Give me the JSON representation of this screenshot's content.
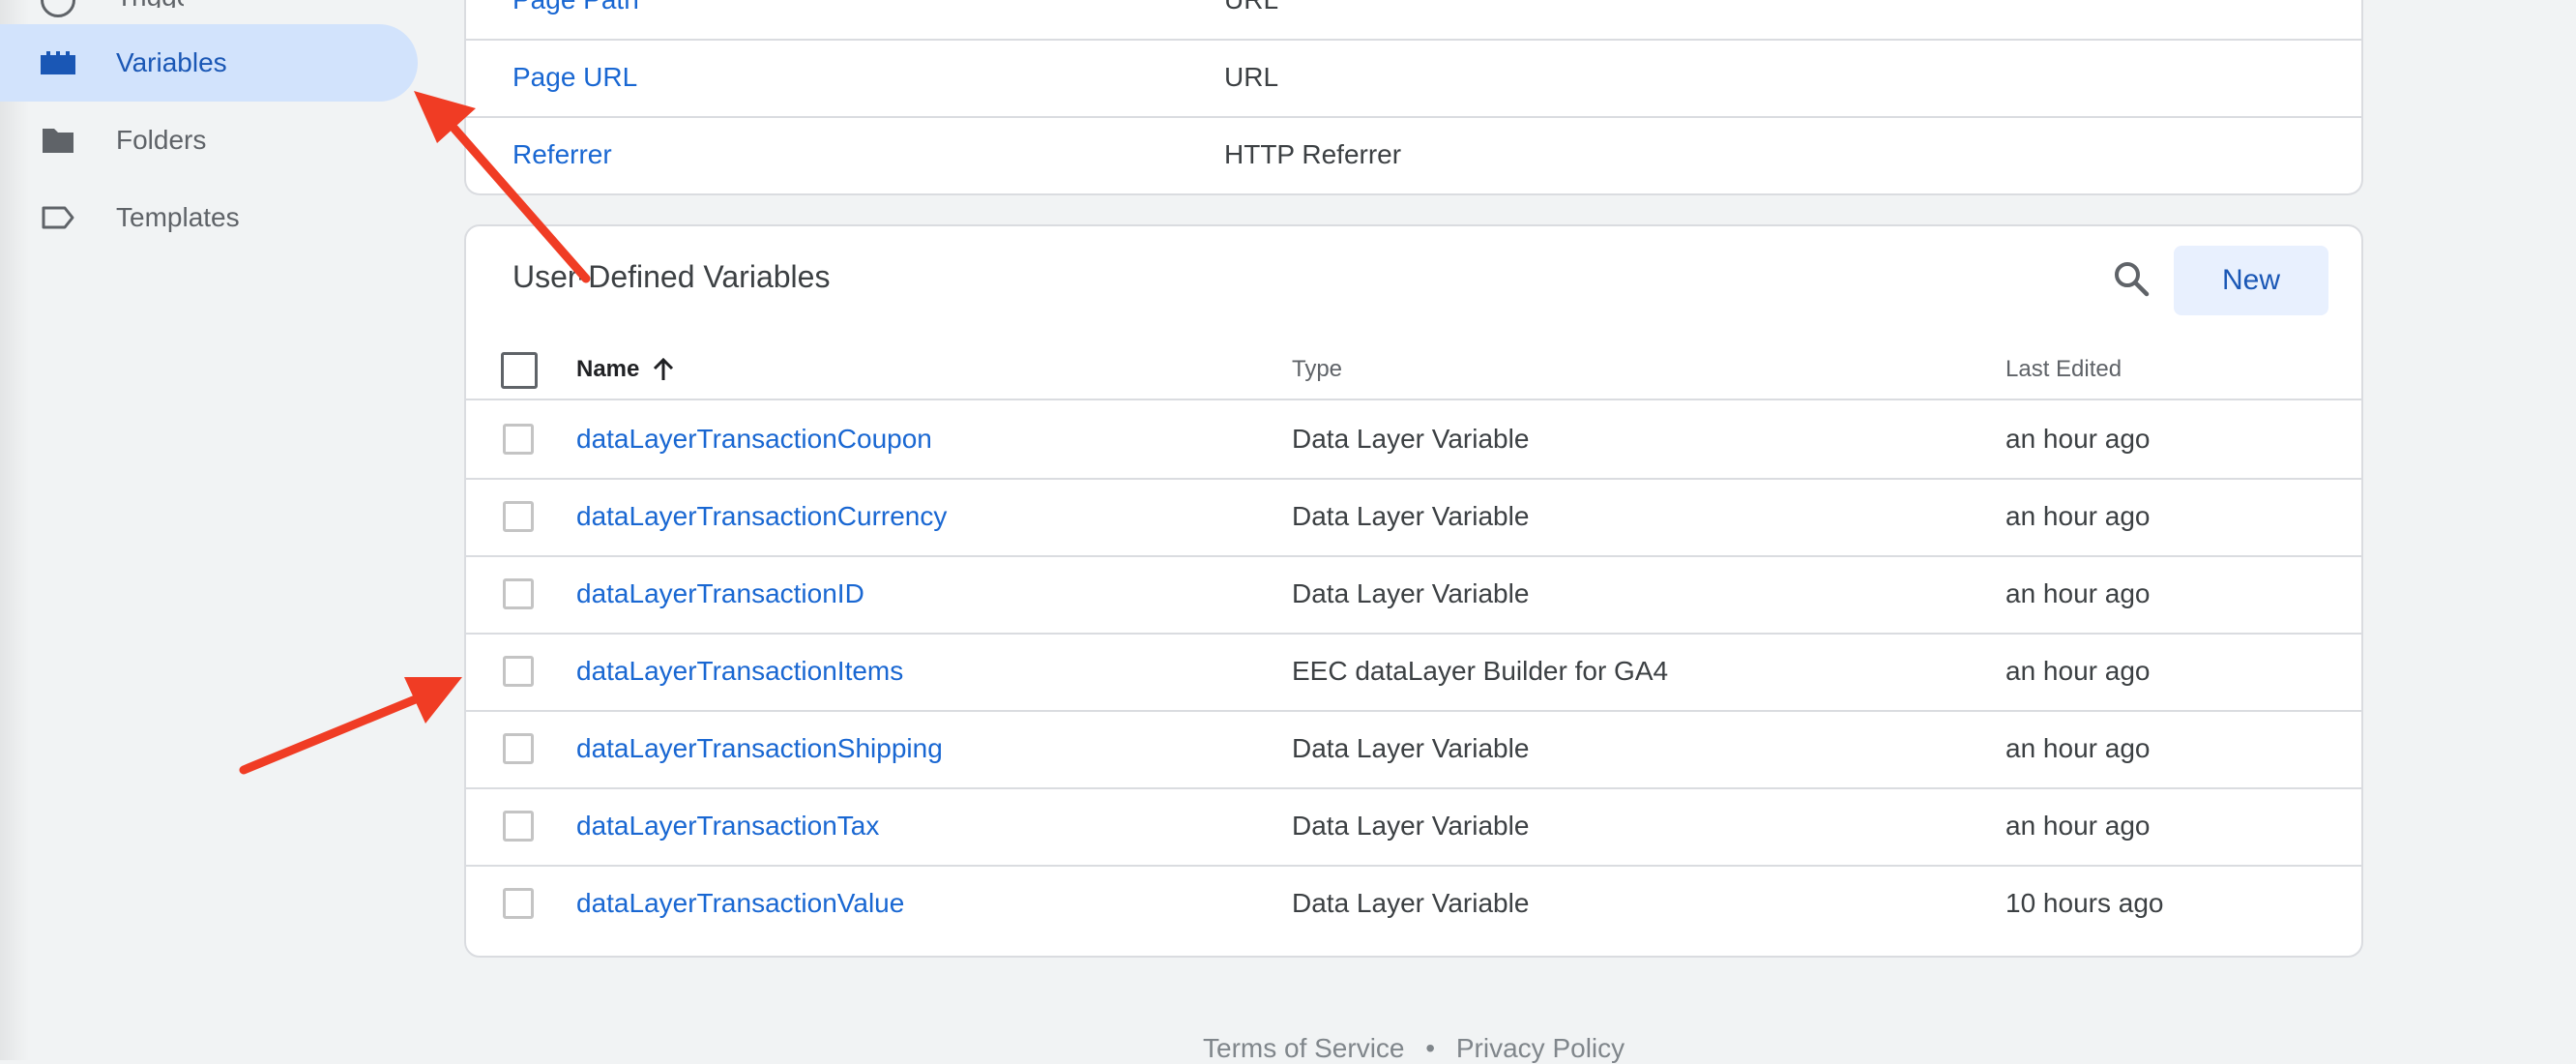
{
  "sidebar": {
    "partial_label": "Triggers",
    "items": [
      {
        "label": "Variables",
        "icon": "variables-icon",
        "active": true
      },
      {
        "label": "Folders",
        "icon": "folder-icon",
        "active": false
      },
      {
        "label": "Templates",
        "icon": "label-icon",
        "active": false
      }
    ]
  },
  "built_in": {
    "rows": [
      {
        "name": "Page Path",
        "type": "URL"
      },
      {
        "name": "Page URL",
        "type": "URL"
      },
      {
        "name": "Referrer",
        "type": "HTTP Referrer"
      }
    ]
  },
  "user_defined": {
    "title": "User-Defined Variables",
    "new_label": "New",
    "columns": {
      "name": "Name",
      "type": "Type",
      "last_edited": "Last Edited"
    },
    "rows": [
      {
        "name": "dataLayerTransactionCoupon",
        "type": "Data Layer Variable",
        "edited": "an hour ago"
      },
      {
        "name": "dataLayerTransactionCurrency",
        "type": "Data Layer Variable",
        "edited": "an hour ago"
      },
      {
        "name": "dataLayerTransactionID",
        "type": "Data Layer Variable",
        "edited": "an hour ago"
      },
      {
        "name": "dataLayerTransactionItems",
        "type": "EEC dataLayer Builder for GA4",
        "edited": "an hour ago"
      },
      {
        "name": "dataLayerTransactionShipping",
        "type": "Data Layer Variable",
        "edited": "an hour ago"
      },
      {
        "name": "dataLayerTransactionTax",
        "type": "Data Layer Variable",
        "edited": "an hour ago"
      },
      {
        "name": "dataLayerTransactionValue",
        "type": "Data Layer Variable",
        "edited": "10 hours ago"
      }
    ]
  },
  "footer": {
    "terms": "Terms of Service",
    "separator": "•",
    "privacy": "Privacy Policy"
  },
  "colors": {
    "accent": "#1a57b5",
    "link": "#1967d2",
    "active_bg": "#d2e3fc",
    "annotation": "#f03c24"
  }
}
